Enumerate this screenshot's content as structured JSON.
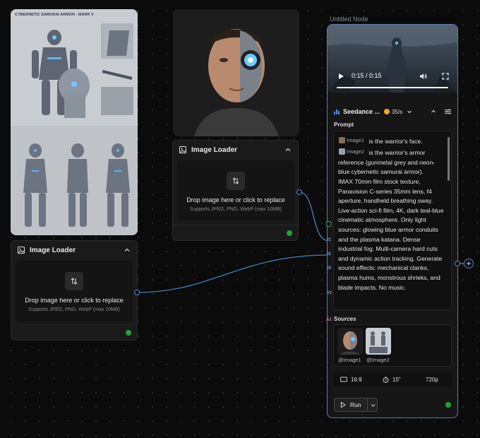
{
  "canvas": {
    "background": "#0b0b0b",
    "edge_color": "#4a7fb8",
    "status_color": "#22a13b",
    "accent_color": "#5e7bb0"
  },
  "reference_sheet": {
    "caption": "CYBERNETIC SAMURAI ARMOR - MARK V"
  },
  "loader_1": {
    "title": "Image Loader",
    "icon": "image-icon",
    "drop_title": "Drop image here or click to replace",
    "drop_subtitle": "Supports JPEG, PNG, WebP (max 10MB)"
  },
  "loader_2": {
    "title": "Image Loader",
    "icon": "image-icon",
    "drop_title": "Drop image here or click to replace",
    "drop_subtitle": "Supports JPEG, PNG, WebP (max 10MB)"
  },
  "seedance": {
    "node_title": "Untitled Node",
    "video": {
      "time": "0:15 / 0:15",
      "progress": 1.0
    },
    "model_name": "Seedance ...",
    "cost": "35/s",
    "prompt_label": "Prompt",
    "prompt": {
      "ref1": "Image1",
      "ref1_text": "is the warrior's face.",
      "ref2": "Image2",
      "ref2_text": "is the warrior's armor reference (gunmetal grey and neon-blue cybernetic samurai armor).",
      "body": "IMAX 70mm film stock texture, Panavision C-series 35mm lens, f4 aperture, handheld breathing sway. Live-action sci-fi film, 4K, dark teal-blue cinematic atmosphere. Only light sources: glowing blue armor conduits and the plasma katana. Dense industrial fog. Multi-camera hard cuts and dynamic action tracking. Generate sound effects: mechanical clanks, plasma hums, monstrous shrieks, and blade impacts. No music."
    },
    "sources_label": "Sources",
    "sources": [
      {
        "label": "@Image1"
      },
      {
        "label": "@Image2"
      }
    ],
    "settings": {
      "aspect": "16:9",
      "duration": "15\"",
      "resolution": "720p"
    },
    "run_label": "Run",
    "ports": [
      "I1",
      "I2",
      "I3",
      "V1",
      "A1"
    ]
  }
}
